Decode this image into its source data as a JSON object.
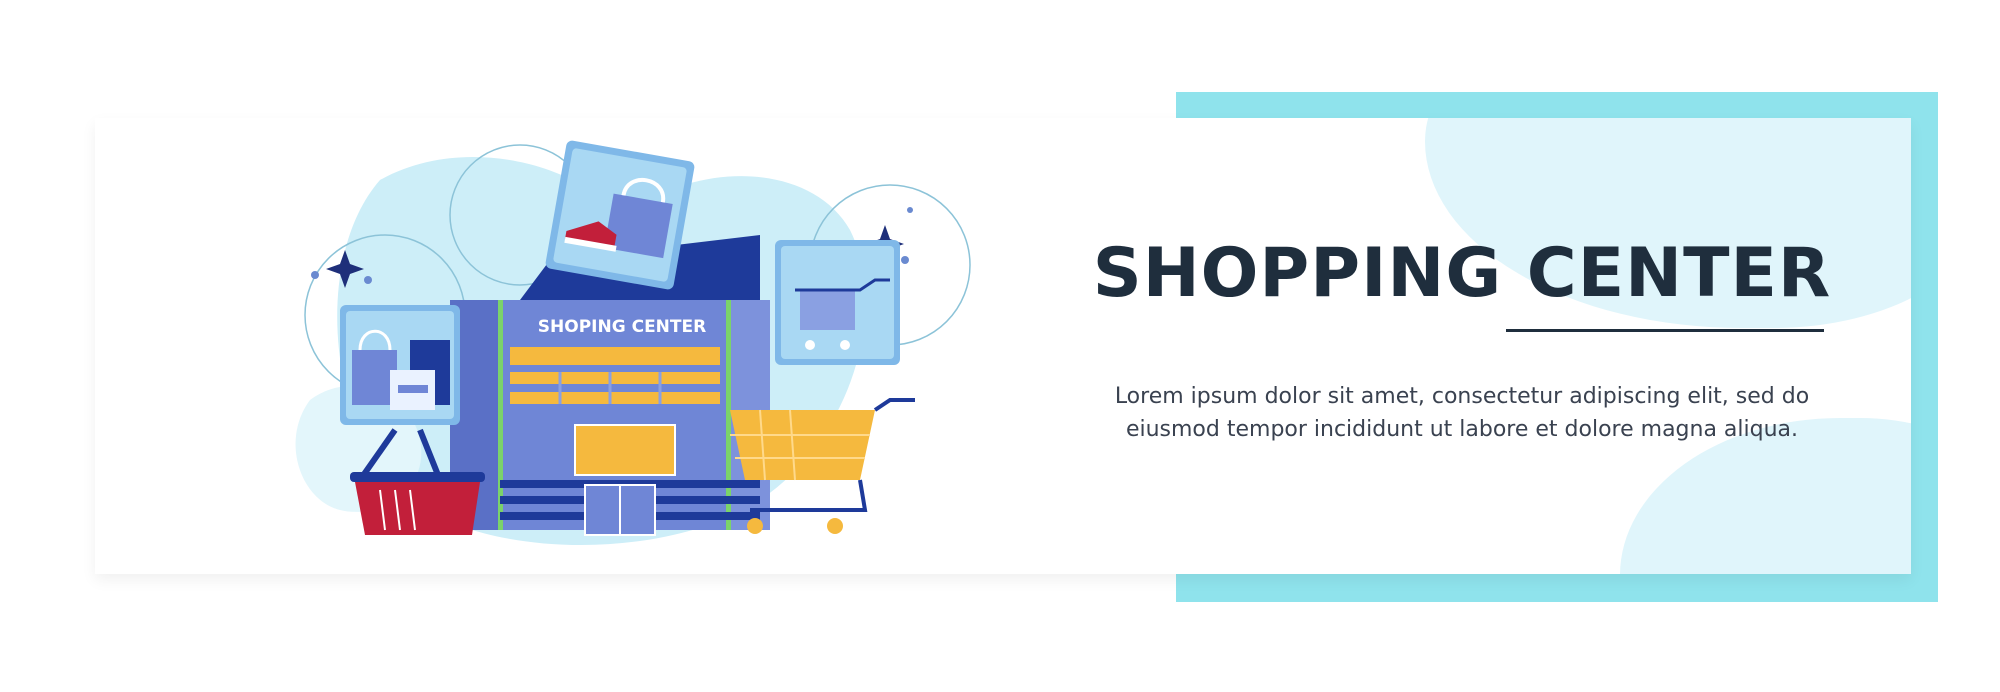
{
  "banner": {
    "title": "SHOPPING CENTER",
    "description": "Lorem ipsum dolor sit amet, consectetur adipiscing elit, sed do eiusmod tempor incididunt ut labore et dolore magna aliqua."
  },
  "illustration": {
    "store_sign": "SHOPING CENTER",
    "icons": [
      "shopping-bags-icon",
      "shoe-bag-icon",
      "shopping-cart-icon",
      "basket-icon",
      "cart-icon",
      "sparkle-icon"
    ]
  },
  "colors": {
    "frame_cyan": "#8fe3ec",
    "blob_light": "#e0f5fb",
    "title_dark": "#1f2e3d",
    "store_blue": "#6f86d6",
    "navy": "#1e3a9a",
    "yellow": "#f5b93e",
    "basket_red": "#c21f3a",
    "tile_blue": "#7fb8e8"
  }
}
